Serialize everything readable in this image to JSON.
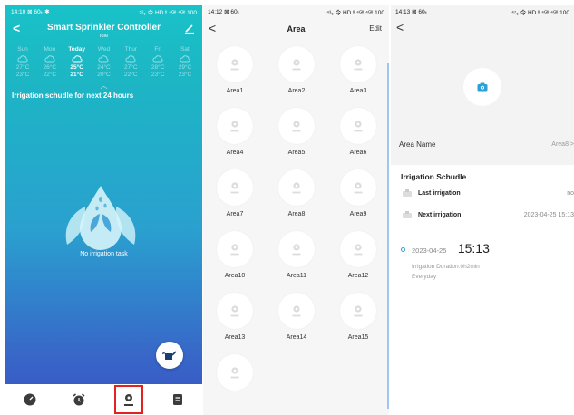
{
  "screen1": {
    "status_left": "14:10 ⊠ 60ₖ ✱",
    "status_right": "⁵²₆ 令 HD ᴵᴵ ⁴ᴳᴵᴵ ⁴ᴳᴵᴵ 100",
    "title": "Smart Sprinkler Controller",
    "subtitle": "Idle",
    "weather": [
      {
        "day": "Sun",
        "high": "27°C",
        "low": "23°C",
        "today": false
      },
      {
        "day": "Mon",
        "high": "26°C",
        "low": "22°C",
        "today": false
      },
      {
        "day": "Today",
        "high": "25°C",
        "low": "21°C",
        "today": true
      },
      {
        "day": "Wed",
        "high": "24°C",
        "low": "20°C",
        "today": false
      },
      {
        "day": "Thur",
        "high": "27°C",
        "low": "22°C",
        "today": false
      },
      {
        "day": "Fri",
        "high": "28°C",
        "low": "23°C",
        "today": false
      },
      {
        "day": "Sat",
        "high": "29°C",
        "low": "23°C",
        "today": false
      }
    ],
    "schedule_title": "Irrigation schudle for next 24 hours",
    "empty_text": "No irrigation task",
    "nav": [
      "dashboard-icon",
      "alarm-clock-icon",
      "area-pin-icon",
      "document-icon"
    ],
    "selected_nav": 2
  },
  "screen2": {
    "status_left": "14:12 ⊠ 60ₖ",
    "status_right": "⁴³₆ 令 HD ᴵᴵ ⁴ᴳᴵᴵ ⁴ᴳᴵᴵ 100",
    "title": "Area",
    "edit": "Edit",
    "areas": [
      "Area1",
      "Area2",
      "Area3",
      "Area4",
      "Area5",
      "Area6",
      "Area7",
      "Area8",
      "Area9",
      "Area10",
      "Area11",
      "Area12",
      "Area13",
      "Area14",
      "Area15",
      ""
    ]
  },
  "screen3": {
    "status_left": "14:13 ⊠ 60ₖ",
    "status_right": "⁴⁷₆ 令 HD ᴵᴵ ⁴ᴳᴵᴵ ⁴ᴳᴵᴵ 100",
    "area_name_label": "Area Name",
    "area_name_value": "Area8 >",
    "irrigation_title": "Irrigation Schudle",
    "last_label": "Last irrigation",
    "last_value": "no",
    "next_label": "Next irrigation",
    "next_value": "2023-04-25 15:13",
    "entry_date": "2023-04-25",
    "entry_time": "15:13",
    "entry_detail": "Irrigation  Duration:0h2min",
    "entry_repeat": "Everyday"
  },
  "colors": {
    "accent": "#2b9fd8",
    "highlight_box": "#e52020"
  }
}
